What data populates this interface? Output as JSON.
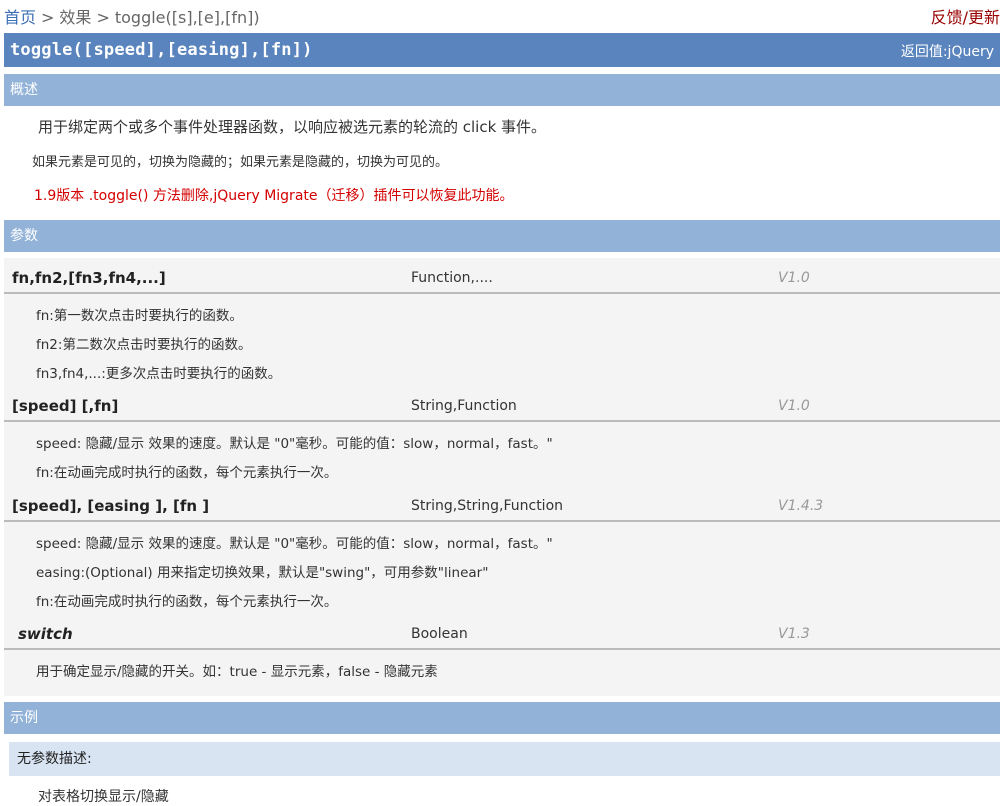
{
  "breadcrumb": {
    "home": "首页",
    "separator": ">",
    "level1": "效果",
    "current": "toggle([s],[e],[fn])"
  },
  "feedback": "反馈/更新",
  "title": {
    "name": "toggle([speed],[easing],[fn])",
    "return": "返回值:jQuery"
  },
  "sections": {
    "overview": "概述",
    "params": "参数",
    "example": "示例"
  },
  "overview": {
    "line1": "用于绑定两个或多个事件处理器函数，以响应被选元素的轮流的 click 事件。",
    "line2": "如果元素是可见的，切换为隐藏的；如果元素是隐藏的，切换为可见的。",
    "notice": "1.9版本 .toggle() 方法删除,jQuery Migrate（迁移）插件可以恢复此功能。"
  },
  "params": [
    {
      "name": "fn,fn2,[fn3,fn4,...]",
      "type": "Function,....",
      "version": "V1.0",
      "lines": [
        "fn:第一数次点击时要执行的函数。",
        "fn2:第二数次点击时要执行的函数。",
        "fn3,fn4,...:更多次点击时要执行的函数。"
      ]
    },
    {
      "name": "[speed] [,fn]",
      "type": "String,Function",
      "version": "V1.0",
      "lines": [
        "speed: 隐藏/显示 效果的速度。默认是 \"0\"毫秒。可能的值：slow，normal，fast。\"",
        "fn:在动画完成时执行的函数，每个元素执行一次。"
      ]
    },
    {
      "name": "[speed], [easing ], [fn ]",
      "type": "String,String,Function",
      "version": "V1.4.3",
      "lines": [
        "speed: 隐藏/显示 效果的速度。默认是 \"0\"毫秒。可能的值：slow，normal，fast。\"",
        "easing:(Optional) 用来指定切换效果，默认是\"swing\"，可用参数\"linear\"",
        "fn:在动画完成时执行的函数，每个元素执行一次。"
      ]
    },
    {
      "name": "switch",
      "type": "Boolean",
      "version": "V1.3",
      "lines": [
        "用于确定显示/隐藏的开关。如：true - 显示元素，false - 隐藏元素"
      ]
    }
  ],
  "example": {
    "subtitle": "无参数描述:",
    "text": "对表格切换显示/隐藏"
  },
  "colors": {
    "title_bar": "#5a84bd",
    "section_bar": "#93b2d8",
    "notice": "#d40000",
    "feedback": "#990000",
    "link": "#3d6fb4"
  }
}
